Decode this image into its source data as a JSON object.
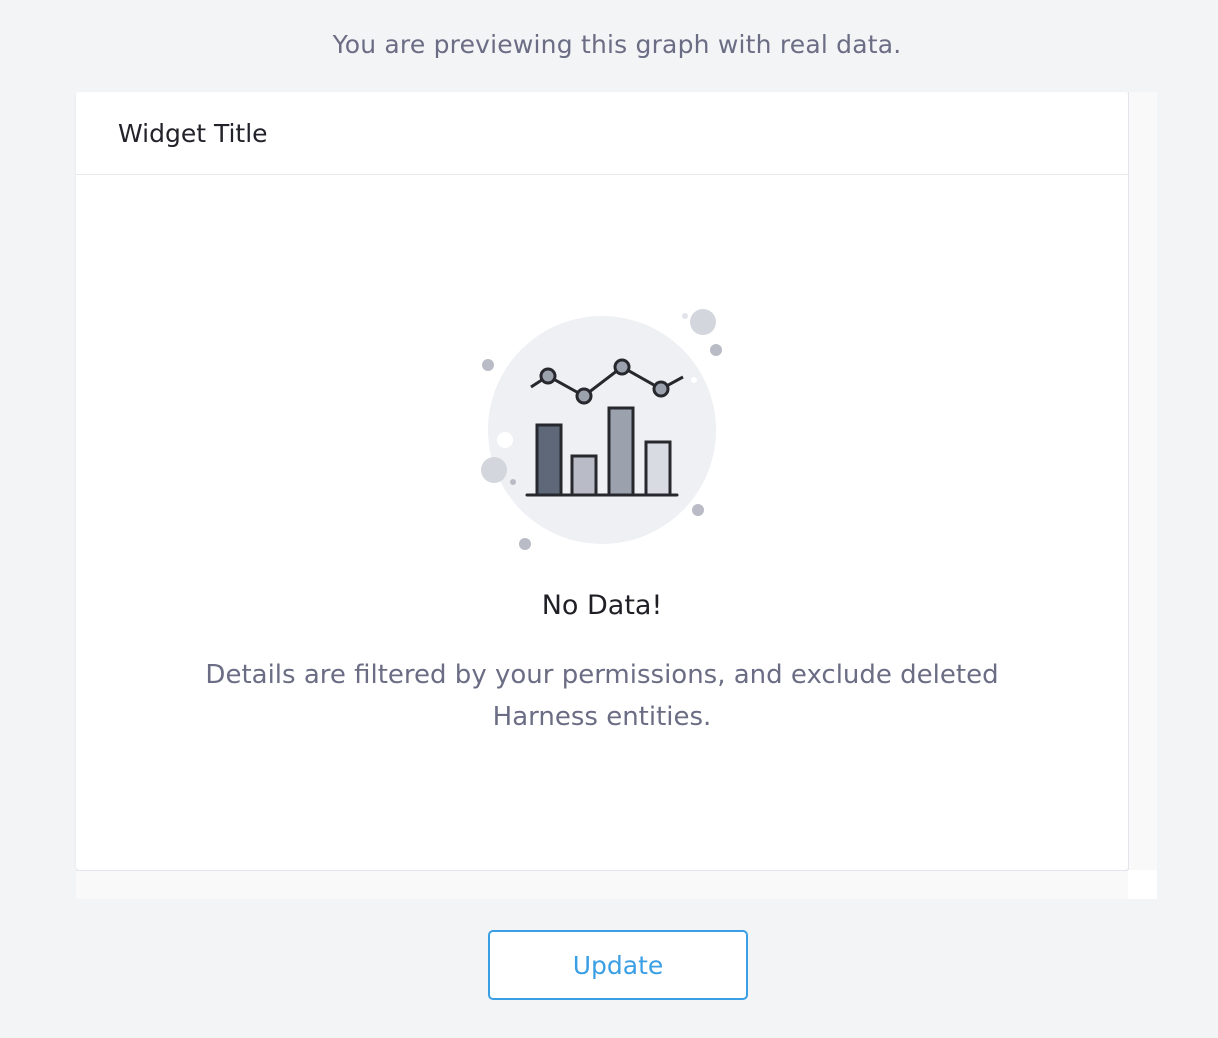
{
  "preview_note": "You are previewing this graph with real data.",
  "widget": {
    "title": "Widget Title",
    "empty_state": {
      "icon": "bar-line-chart-illustration",
      "title": "No Data!",
      "description": "Details are filtered by your permissions, and exclude deleted Harness entities."
    }
  },
  "actions": {
    "update_label": "Update"
  },
  "colors": {
    "background": "#f3f4f6",
    "accent": "#3b9fe5",
    "muted_text": "#6b6d85"
  }
}
